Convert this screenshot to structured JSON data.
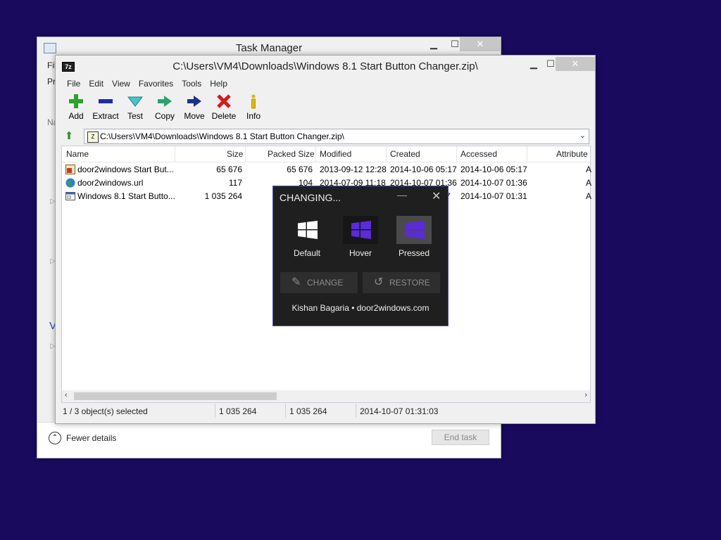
{
  "task_manager": {
    "title": "Task Manager",
    "menu_partial": "Fil",
    "tab_partial": "Pr",
    "side_partial_na": "Na",
    "side_partial_v": "V",
    "fewer_details": "Fewer details",
    "end_task": "End task"
  },
  "zip": {
    "title": "C:\\Users\\VM4\\Downloads\\Windows 8.1 Start Button Changer.zip\\",
    "app_icon_text": "7z",
    "menu": [
      "File",
      "Edit",
      "View",
      "Favorites",
      "Tools",
      "Help"
    ],
    "toolbar": [
      {
        "label": "Add",
        "icon": "plus-icon"
      },
      {
        "label": "Extract",
        "icon": "minus-icon"
      },
      {
        "label": "Test",
        "icon": "check-icon"
      },
      {
        "label": "Copy",
        "icon": "copy-arrow-icon"
      },
      {
        "label": "Move",
        "icon": "move-arrow-icon"
      },
      {
        "label": "Delete",
        "icon": "x-icon"
      },
      {
        "label": "Info",
        "icon": "info-icon"
      }
    ],
    "address": "C:\\Users\\VM4\\Downloads\\Windows 8.1 Start Button Changer.zip\\",
    "columns": [
      "Name",
      "Size",
      "Packed Size",
      "Modified",
      "Created",
      "Accessed",
      "Attribute"
    ],
    "rows": [
      {
        "name": "door2windows Start But...",
        "size": "65 676",
        "packed": "65 676",
        "modified": "2013-09-12 12:28",
        "created": "2014-10-06 05:17",
        "accessed": "2014-10-06 05:17",
        "attr": "A"
      },
      {
        "name": "door2windows.url",
        "size": "117",
        "packed": "104",
        "modified": "2014-07-09 11:18",
        "created": "2014-10-07 01:36",
        "accessed": "2014-10-07 01:36",
        "attr": "A"
      },
      {
        "name": "Windows 8.1 Start Butto...",
        "size": "1 035 264",
        "packed": "",
        "modified": "",
        "created": "7",
        "accessed": "2014-10-07 01:31",
        "attr": "A"
      }
    ],
    "status": {
      "selected": "1 / 3 object(s) selected",
      "size": "1 035 264",
      "packed": "1 035 264",
      "date": "2014-10-07 01:31:03"
    }
  },
  "dialog": {
    "title": "CHANGING...",
    "min": "—",
    "close": "✕",
    "tiles": [
      "Default",
      "Hover",
      "Pressed"
    ],
    "change_label": "CHANGE",
    "restore_label": "RESTORE",
    "credit": "Kishan Bagaria • door2windows.com",
    "colors": {
      "default": "#ffffff",
      "accent": "#5b2bd8"
    }
  }
}
